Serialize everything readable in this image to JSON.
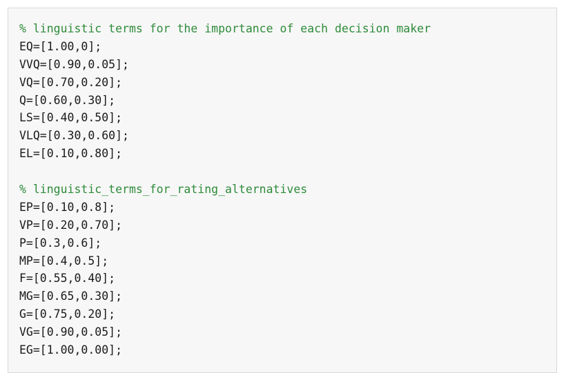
{
  "code": {
    "lines": [
      {
        "kind": "comment",
        "text": "% linguistic terms for the importance of each decision maker"
      },
      {
        "kind": "code",
        "text": "EQ=[1.00,0];"
      },
      {
        "kind": "code",
        "text": "VVQ=[0.90,0.05];"
      },
      {
        "kind": "code",
        "text": "VQ=[0.70,0.20];"
      },
      {
        "kind": "code",
        "text": "Q=[0.60,0.30];"
      },
      {
        "kind": "code",
        "text": "LS=[0.40,0.50];"
      },
      {
        "kind": "code",
        "text": "VLQ=[0.30,0.60];"
      },
      {
        "kind": "code",
        "text": "EL=[0.10,0.80];"
      },
      {
        "kind": "blank",
        "text": ""
      },
      {
        "kind": "comment",
        "text": "% linguistic_terms_for_rating_alternatives"
      },
      {
        "kind": "code",
        "text": "EP=[0.10,0.8];"
      },
      {
        "kind": "code",
        "text": "VP=[0.20,0.70];"
      },
      {
        "kind": "code",
        "text": "P=[0.3,0.6];"
      },
      {
        "kind": "code",
        "text": "MP=[0.4,0.5];"
      },
      {
        "kind": "code",
        "text": "F=[0.55,0.40];"
      },
      {
        "kind": "code",
        "text": "MG=[0.65,0.30];"
      },
      {
        "kind": "code",
        "text": "G=[0.75,0.20];"
      },
      {
        "kind": "code",
        "text": "VG=[0.90,0.05];"
      },
      {
        "kind": "code",
        "text": "EG=[1.00,0.00];"
      }
    ]
  },
  "colors": {
    "comment": "#2e8b3a",
    "code_text": "#1a1a1a",
    "background": "#f7f7f7",
    "border": "#d8d8d8"
  }
}
